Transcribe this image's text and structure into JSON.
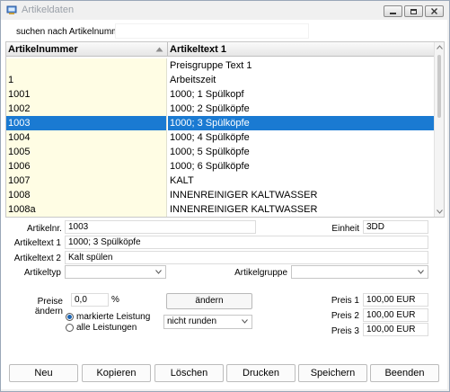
{
  "window": {
    "title": "Artikeldaten",
    "controls": [
      "minimize",
      "restore",
      "close"
    ]
  },
  "search": {
    "label": "suchen nach Artikelnummer",
    "value": ""
  },
  "table": {
    "columns": [
      "Artikelnummer",
      "Artikeltext 1"
    ],
    "sort_column": "Artikelnummer",
    "selected_index": 4,
    "rows": [
      {
        "nr": "",
        "text": "Preisgruppe Text 1"
      },
      {
        "nr": "1",
        "text": "Arbeitszeit"
      },
      {
        "nr": "1001",
        "text": "1000; 1 Spülkopf"
      },
      {
        "nr": "1002",
        "text": "1000; 2 Spülköpfe"
      },
      {
        "nr": "1003",
        "text": "1000; 3 Spülköpfe"
      },
      {
        "nr": "1004",
        "text": "1000; 4 Spülköpfe"
      },
      {
        "nr": "1005",
        "text": "1000; 5 Spülköpfe"
      },
      {
        "nr": "1006",
        "text": "1000; 6 Spülköpfe"
      },
      {
        "nr": "1007",
        "text": "KALT"
      },
      {
        "nr": "1008",
        "text": "INNENREINIGER KALTWASSER"
      },
      {
        "nr": "1008a",
        "text": "INNENREINIGER KALTWASSER"
      }
    ]
  },
  "form": {
    "artikelnr_label": "Artikelnr.",
    "artikelnr_value": "1003",
    "einheit_label": "Einheit",
    "einheit_value": "3DD",
    "text1_label": "Artikeltext 1",
    "text1_value": "1000; 3 Spülköpfe",
    "text2_label": "Artikeltext 2",
    "text2_value": "Kalt spülen",
    "typ_label": "Artikeltyp",
    "typ_value": "",
    "gruppe_label": "Artikelgruppe",
    "gruppe_value": ""
  },
  "prices": {
    "aendern_label": "Preise ändern",
    "aendern_value": "0,0",
    "percent": "%",
    "aendern_button": "ändern",
    "radio_marked": "markierte Leistung",
    "radio_all": "alle Leistungen",
    "radio_selected": "markierte Leistung",
    "rounding_value": "nicht runden",
    "preis1_label": "Preis 1",
    "preis1_value": "100,00 EUR",
    "preis2_label": "Preis 2",
    "preis2_value": "100,00 EUR",
    "preis3_label": "Preis 3",
    "preis3_value": "100,00 EUR"
  },
  "buttons": {
    "neu": "Neu",
    "kopieren": "Kopieren",
    "loeschen": "Löschen",
    "drucken": "Drucken",
    "speichern": "Speichern",
    "beenden": "Beenden"
  },
  "colors": {
    "selection": "#1a7ad2",
    "key_column_bg": "#fffde4"
  }
}
